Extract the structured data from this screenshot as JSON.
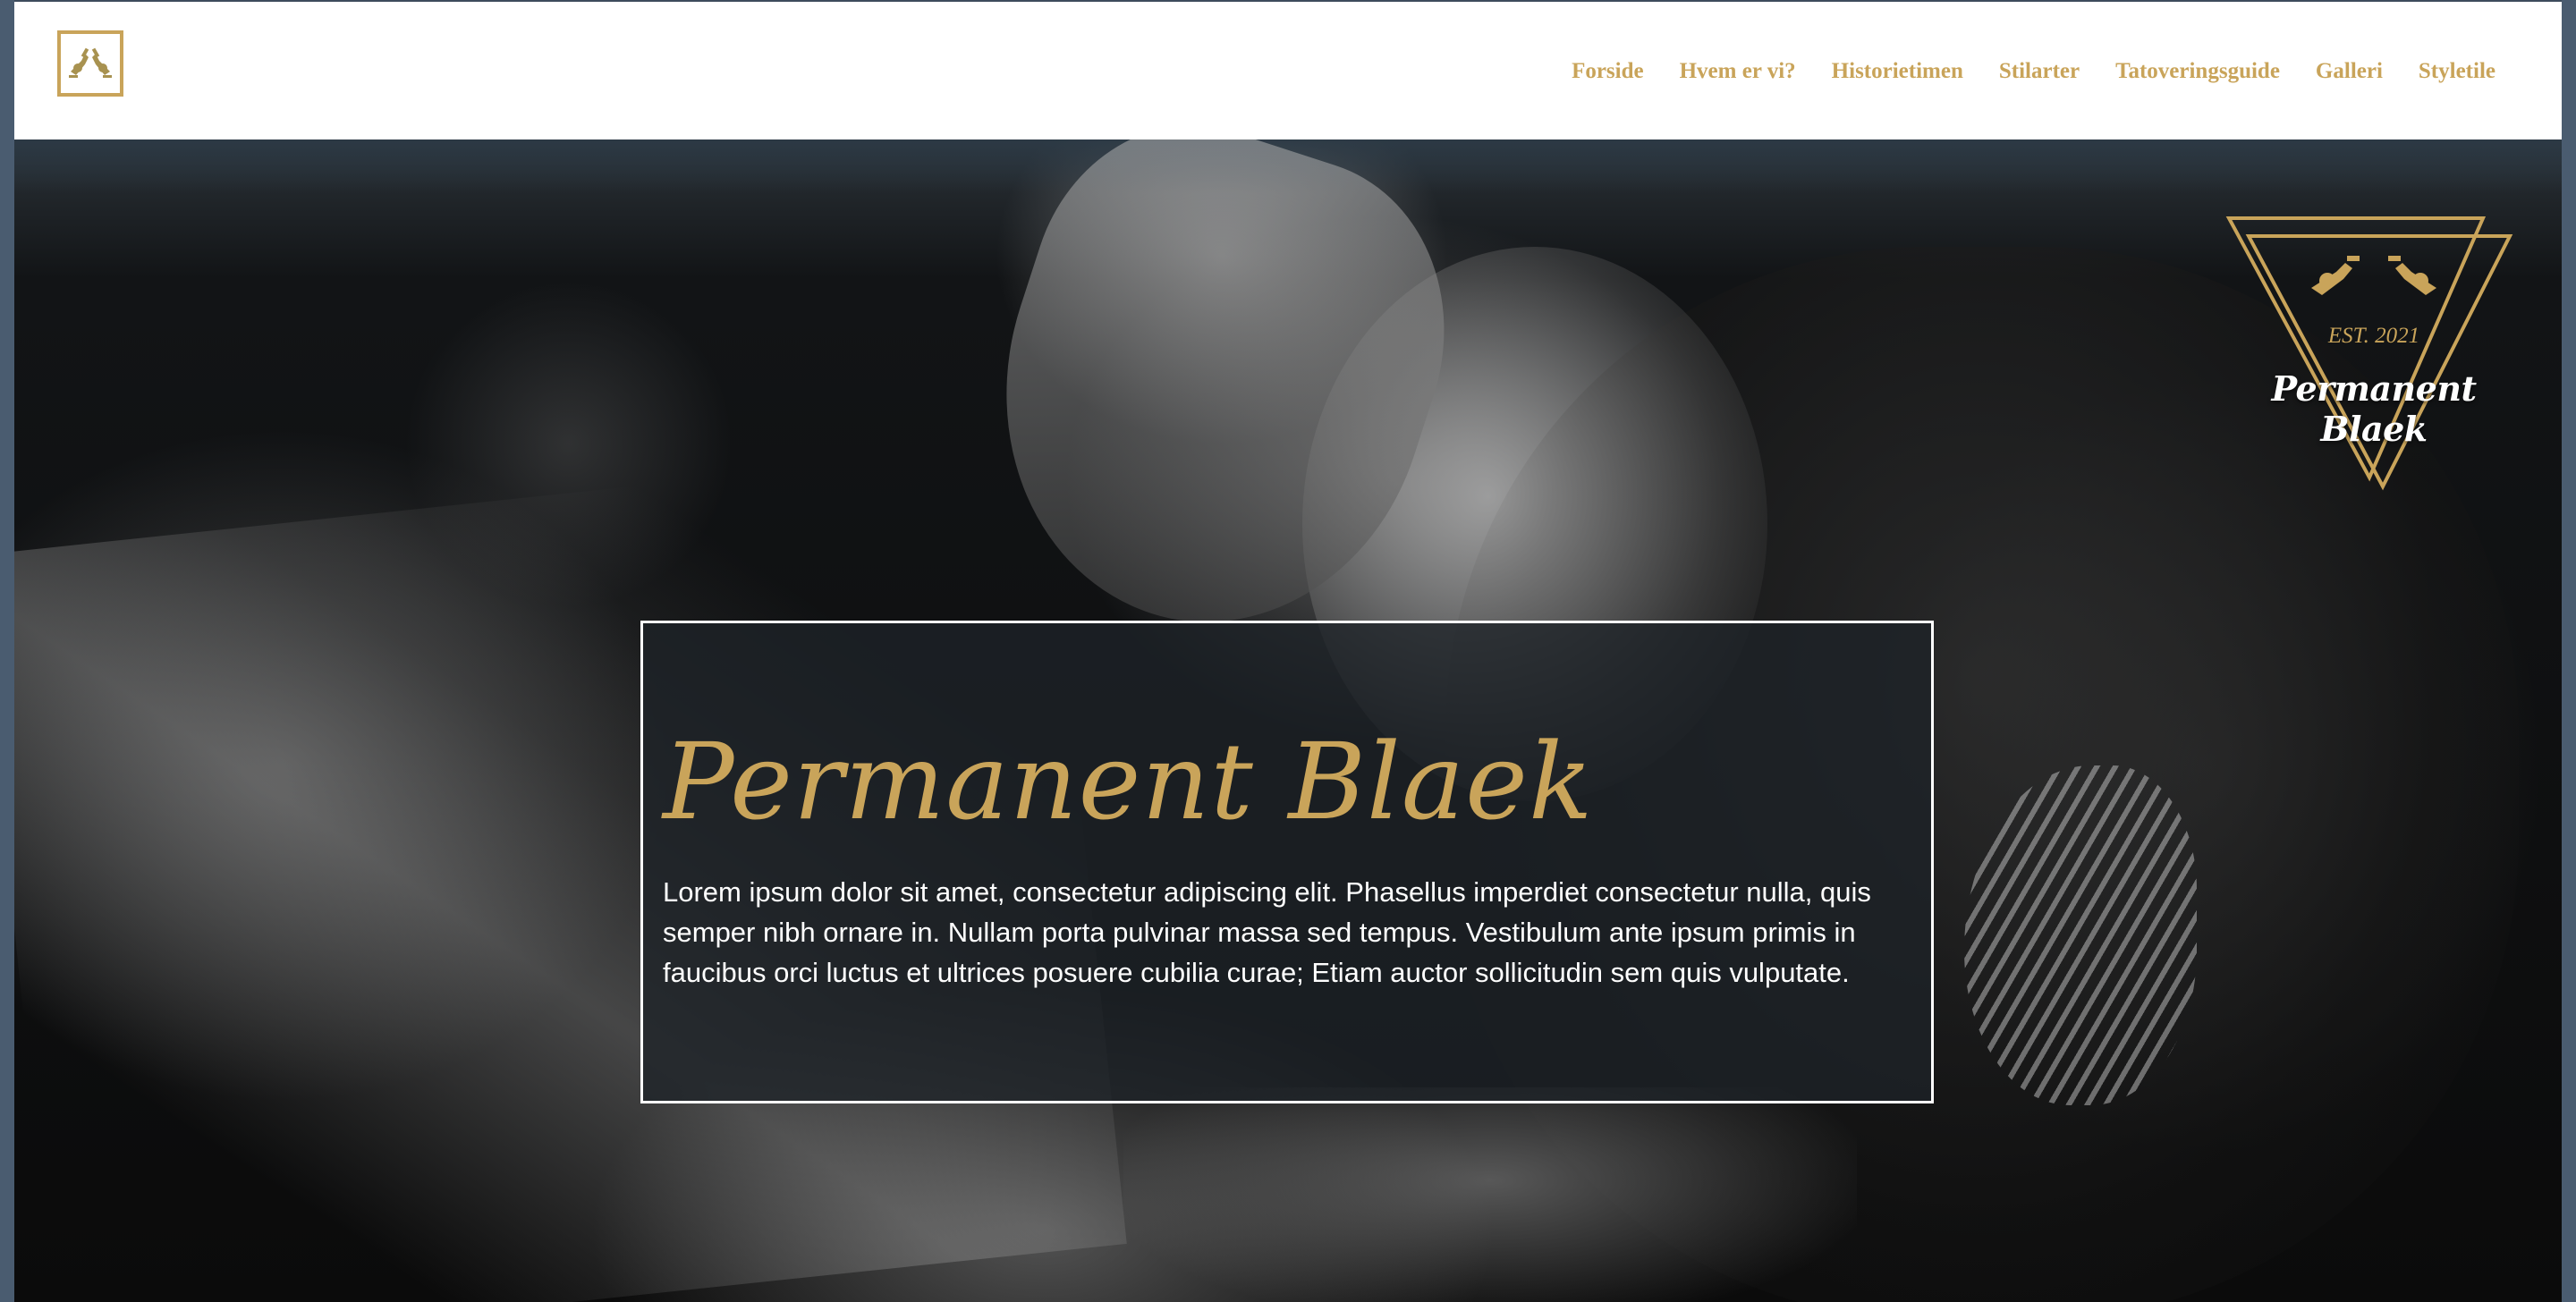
{
  "brand": {
    "name": "Permanent Blaek",
    "established": "EST. 2021",
    "accent_color": "#c9a45a",
    "logo_icon": "tattoo-machines-icon"
  },
  "nav": {
    "items": [
      {
        "label": "Forside"
      },
      {
        "label": "Hvem er vi?"
      },
      {
        "label": "Historietimen"
      },
      {
        "label": "Stilarter"
      },
      {
        "label": "Tatoveringsguide"
      },
      {
        "label": "Galleri"
      },
      {
        "label": "Styletile"
      }
    ]
  },
  "hero": {
    "title": "Permanent Blaek",
    "text": "Lorem ipsum dolor sit amet, consectetur adipiscing elit. Phasellus imperdiet consectetur nulla, quis semper nibh ornare in. Nullam porta pulvinar massa sed tempus. Vestibulum ante ipsum primis in faucibus orci luctus et ultrices posuere cubilia curae; Etiam auctor sollicitudin sem quis vulputate."
  }
}
